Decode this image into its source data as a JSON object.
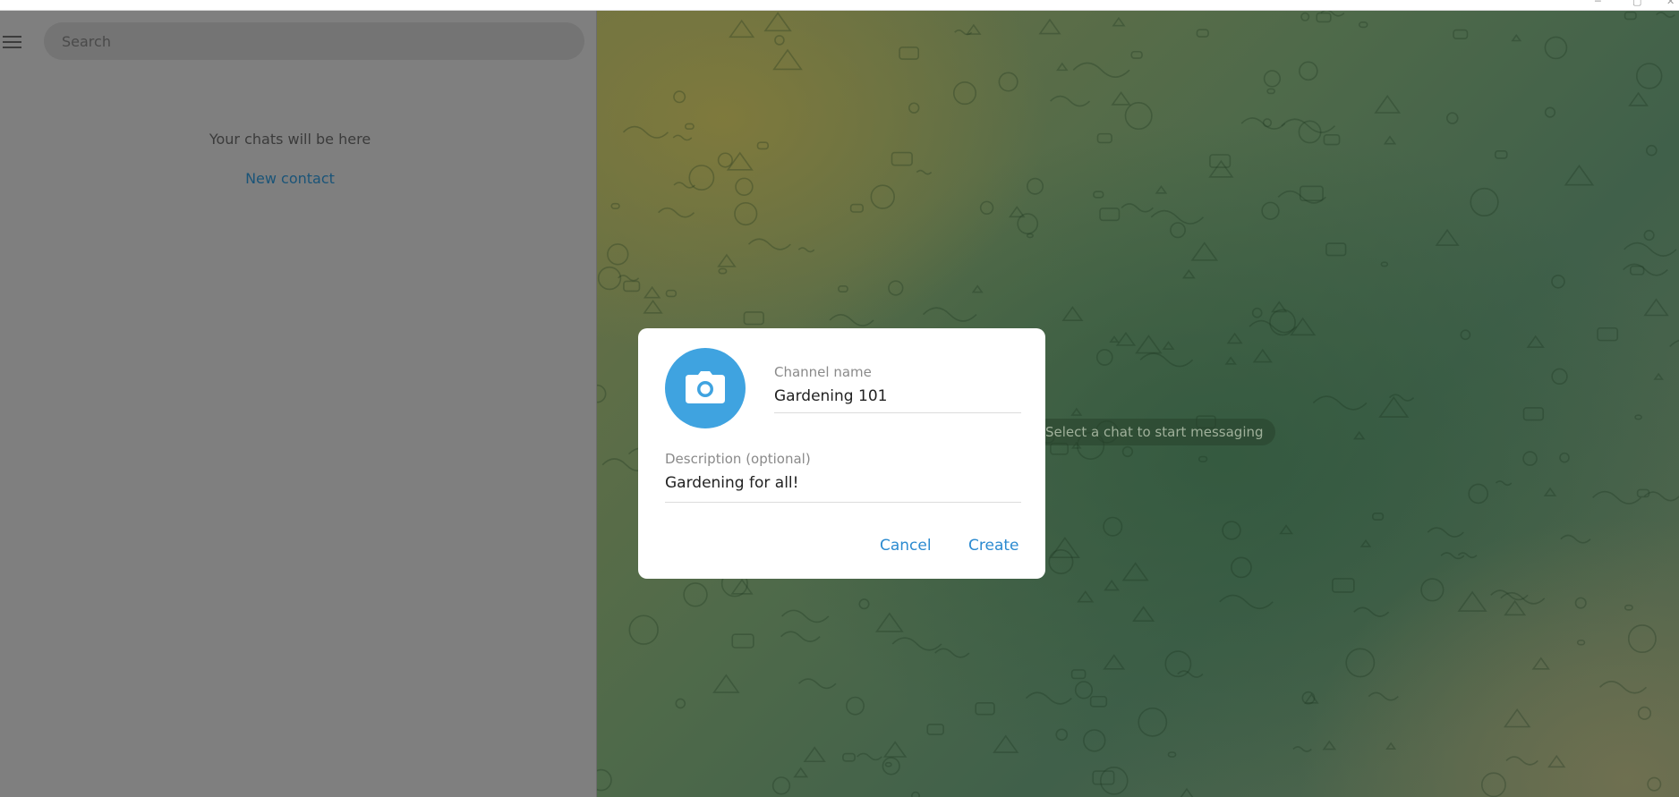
{
  "window": {
    "minimize_glyph": "─",
    "maximize_glyph": "▢",
    "close_glyph": "✕"
  },
  "sidebar": {
    "search": {
      "placeholder": "Search",
      "value": ""
    },
    "empty_text": "Your chats will be here",
    "new_contact_label": "New contact"
  },
  "chat": {
    "placeholder_text": "Select a chat to start messaging"
  },
  "dialog": {
    "channel_name_label": "Channel name",
    "channel_name_value": "Gardening 101",
    "description_label": "Description (optional)",
    "description_value": "Gardening for all!",
    "cancel_label": "Cancel",
    "create_label": "Create"
  },
  "colors": {
    "accent": "#2b8ad0",
    "avatar_bg": "#3fa3e0",
    "link": "#1a5478"
  },
  "icons": {
    "menu": "hamburger-menu-icon",
    "photo": "camera-icon"
  }
}
